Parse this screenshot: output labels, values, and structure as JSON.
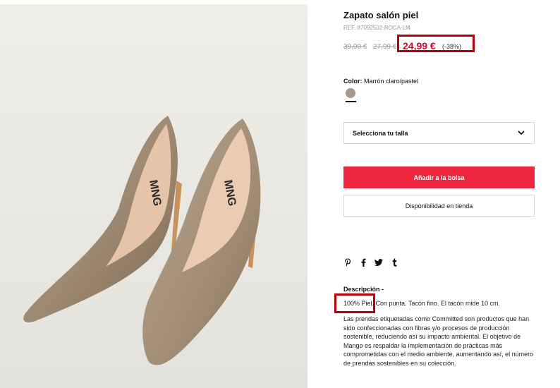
{
  "product": {
    "title": "Zapato salón piel",
    "ref": "REF. 87092502-ROCA-LM",
    "price_original_1": "39,99 €",
    "price_original_2": "27,99 €",
    "price_current": "24,99 €",
    "discount": "(-38%)",
    "color_label": "Color:",
    "color_value": "Marrón claro/pastel",
    "swatch_color": "#a79a8c",
    "accent_red": "#ee263d"
  },
  "size_select": {
    "label": "Selecciona tu talla",
    "icon": "chevron-down-icon"
  },
  "buttons": {
    "add_to_bag": "Añadir a la bolsa",
    "store_availability": "Disponibilidad en tienda"
  },
  "social": [
    {
      "name": "pinterest-icon",
      "glyph": "P"
    },
    {
      "name": "facebook-icon",
      "glyph": "f"
    },
    {
      "name": "twitter-icon",
      "glyph": "🐦"
    },
    {
      "name": "tumblr-icon",
      "glyph": "t"
    }
  ],
  "description": {
    "title": "Descripción -",
    "line1": "100% Piel. Con punta. Tacón fino. El tacón mide 10 cm.",
    "body": "Las prendas etiquetadas como Committed son productos que han sido confeccionadas con fibras y/o procesos de producción sostenible, reduciendo así su impacto ambiental. El objetivo de Mango es respaldar la implementación de prácticas más comprometidas con el medio ambiente, aumentando así, el número de prendas sostenibles en su colección."
  },
  "image": {
    "brand_text": "MNG"
  }
}
